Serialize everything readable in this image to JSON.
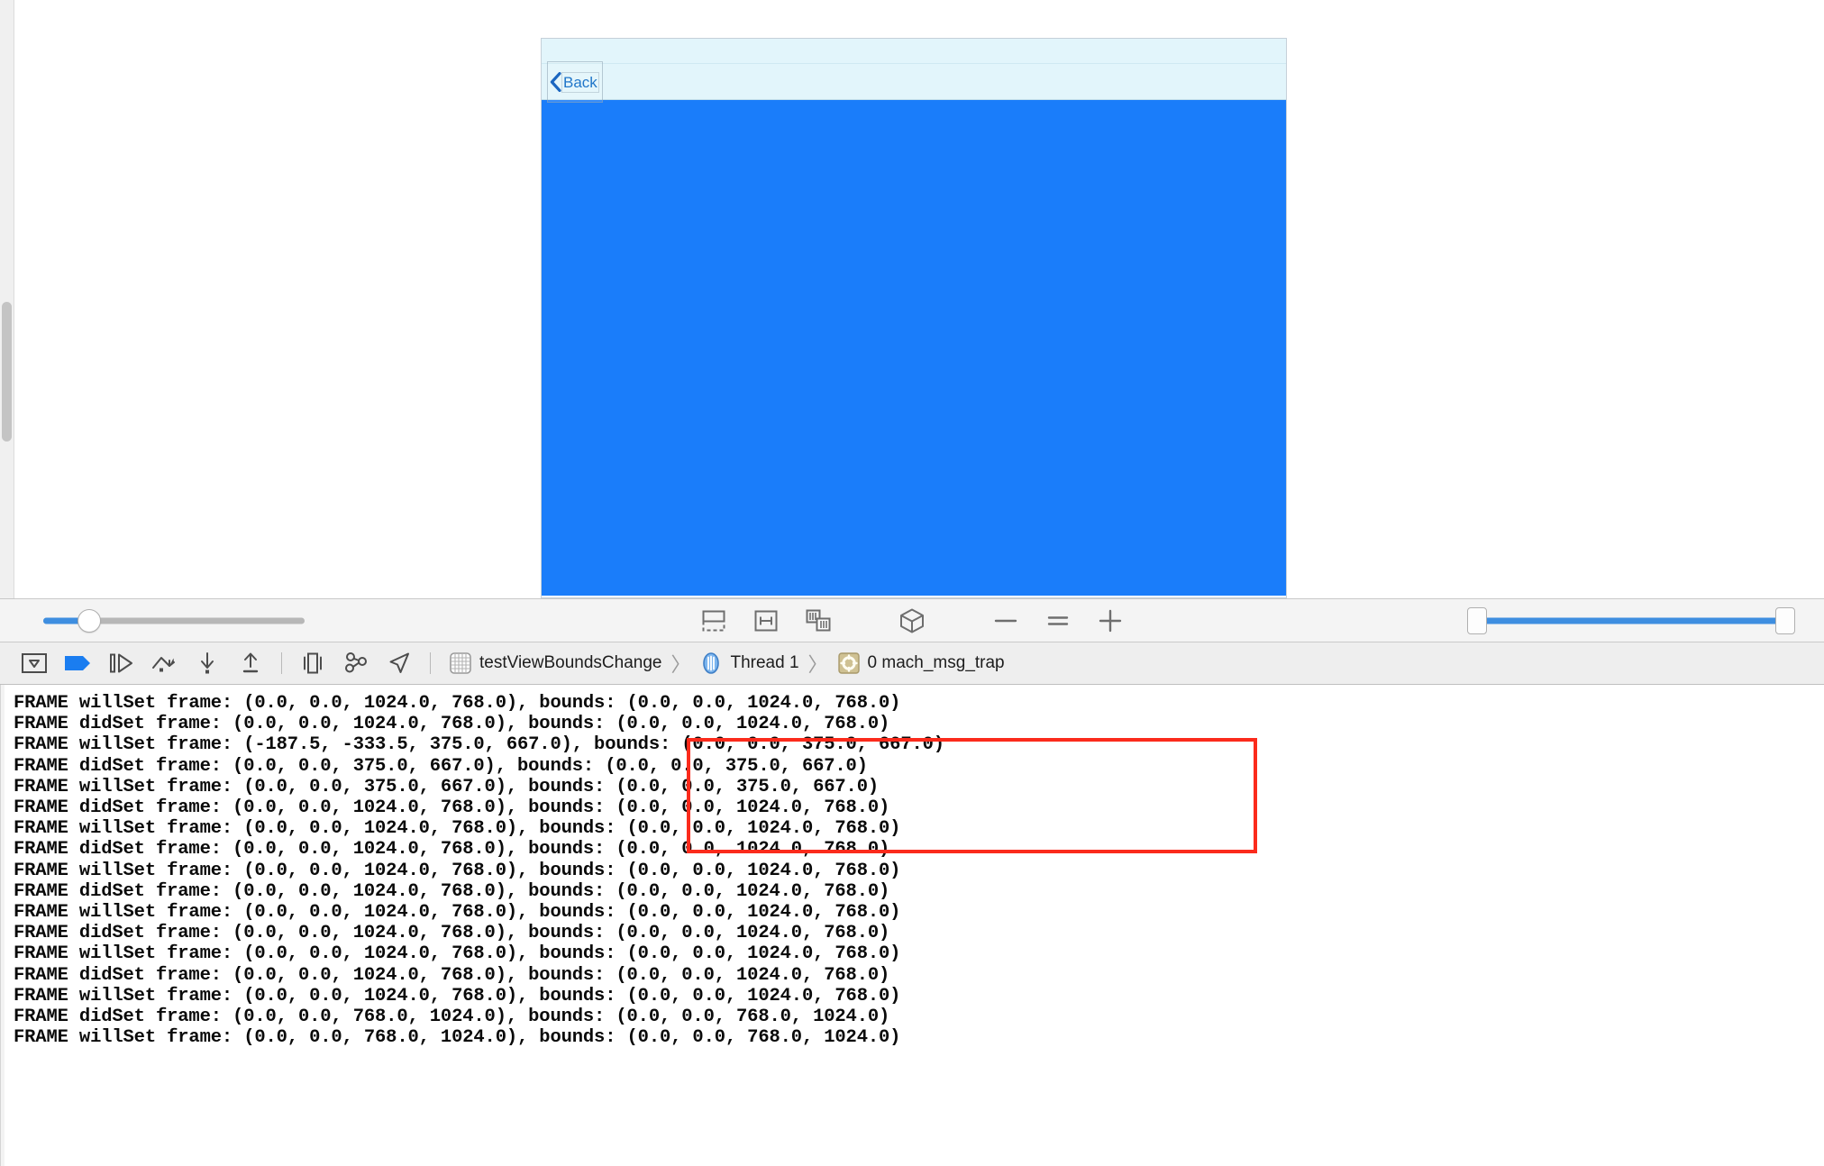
{
  "simulator": {
    "back_button_label": "Back",
    "back_icon": "chevron-left-icon",
    "content_color": "#1a7dfa",
    "navbar_color": "#e2f5fb"
  },
  "debugger_toolbar": {
    "left_slider": {
      "name": "view-spacing-slider",
      "value": 13,
      "min": 0,
      "max": 100
    },
    "tools": [
      {
        "name": "show-clipped-content-icon",
        "label": "Show Clipped Content"
      },
      {
        "name": "show-constraints-icon",
        "label": "Show Constraints"
      },
      {
        "name": "adjust-view-mode-icon",
        "label": "Adjust View Mode"
      },
      {
        "name": "wireframe-cube-icon",
        "label": "Wireframes"
      },
      {
        "name": "zoom-out-icon",
        "label": "Zoom Out"
      },
      {
        "name": "zoom-actual-size-icon",
        "label": "Actual Size"
      },
      {
        "name": "zoom-in-icon",
        "label": "Zoom In"
      }
    ],
    "right_slider": {
      "name": "view-depth-range-slider",
      "low": 0,
      "high": 100
    }
  },
  "debug_bar": {
    "buttons": [
      {
        "name": "hide-debug-area-button",
        "icon": "hide-debug-area-icon"
      },
      {
        "name": "deactivate-breakpoints-button",
        "icon": "breakpoint-arrow-icon"
      },
      {
        "name": "continue-button",
        "icon": "continue-execution-icon"
      },
      {
        "name": "step-over-button",
        "icon": "step-over-icon"
      },
      {
        "name": "step-into-button",
        "icon": "step-into-icon"
      },
      {
        "name": "step-out-button",
        "icon": "step-out-icon"
      },
      {
        "name": "debug-view-hierarchy-button",
        "icon": "view-hierarchy-icon"
      },
      {
        "name": "debug-memory-graph-button",
        "icon": "memory-graph-icon"
      },
      {
        "name": "simulate-location-button",
        "icon": "location-arrow-icon"
      }
    ],
    "breadcrumb": {
      "process_icon": "process-grid-icon",
      "process": "testViewBoundsChange",
      "thread_icon": "thread-icon",
      "thread": "Thread 1",
      "frame_icon": "stack-frame-icon",
      "frame": "0 mach_msg_trap",
      "separator": "〉"
    }
  },
  "console": {
    "annotation": {
      "name": "red-highlight-box",
      "color": "#fb2b1c"
    },
    "lines": [
      "FRAME willSet frame: (0.0, 0.0, 1024.0, 768.0), bounds: (0.0, 0.0, 1024.0, 768.0)",
      "FRAME didSet frame: (0.0, 0.0, 1024.0, 768.0), bounds: (0.0, 0.0, 1024.0, 768.0)",
      "FRAME willSet frame: (-187.5, -333.5, 375.0, 667.0), bounds: (0.0, 0.0, 375.0, 667.0)",
      "FRAME didSet frame: (0.0, 0.0, 375.0, 667.0), bounds: (0.0, 0.0, 375.0, 667.0)",
      "FRAME willSet frame: (0.0, 0.0, 375.0, 667.0), bounds: (0.0, 0.0, 375.0, 667.0)",
      "FRAME didSet frame: (0.0, 0.0, 1024.0, 768.0), bounds: (0.0, 0.0, 1024.0, 768.0)",
      "FRAME willSet frame: (0.0, 0.0, 1024.0, 768.0), bounds: (0.0, 0.0, 1024.0, 768.0)",
      "FRAME didSet frame: (0.0, 0.0, 1024.0, 768.0), bounds: (0.0, 0.0, 1024.0, 768.0)",
      "FRAME willSet frame: (0.0, 0.0, 1024.0, 768.0), bounds: (0.0, 0.0, 1024.0, 768.0)",
      "FRAME didSet frame: (0.0, 0.0, 1024.0, 768.0), bounds: (0.0, 0.0, 1024.0, 768.0)",
      "FRAME willSet frame: (0.0, 0.0, 1024.0, 768.0), bounds: (0.0, 0.0, 1024.0, 768.0)",
      "FRAME didSet frame: (0.0, 0.0, 1024.0, 768.0), bounds: (0.0, 0.0, 1024.0, 768.0)",
      "FRAME willSet frame: (0.0, 0.0, 1024.0, 768.0), bounds: (0.0, 0.0, 1024.0, 768.0)",
      "FRAME didSet frame: (0.0, 0.0, 1024.0, 768.0), bounds: (0.0, 0.0, 1024.0, 768.0)",
      "FRAME willSet frame: (0.0, 0.0, 1024.0, 768.0), bounds: (0.0, 0.0, 1024.0, 768.0)",
      "FRAME didSet frame: (0.0, 0.0, 768.0, 1024.0), bounds: (0.0, 0.0, 768.0, 1024.0)",
      "FRAME willSet frame: (0.0, 0.0, 768.0, 1024.0), bounds: (0.0, 0.0, 768.0, 1024.0)"
    ]
  }
}
